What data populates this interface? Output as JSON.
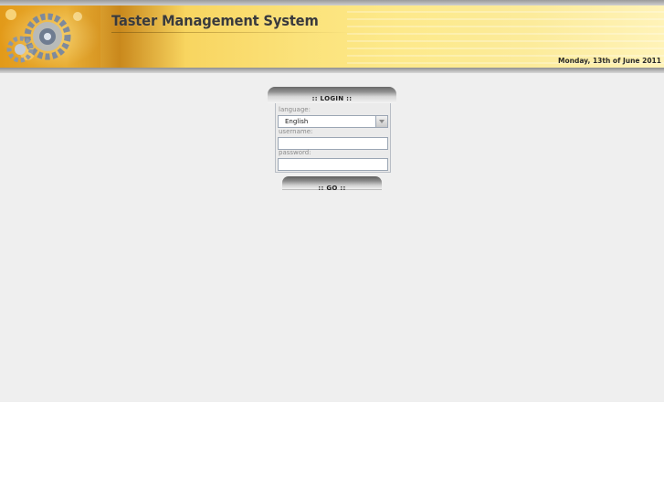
{
  "header": {
    "app_title": "Taster Management System",
    "date": "Monday, 13th of June 2011"
  },
  "login": {
    "title": ":: LOGIN ::",
    "language_label": "language:",
    "language_value": "English",
    "username_label": "username:",
    "username_value": "",
    "password_label": "password:",
    "password_value": "",
    "go_label": ":: GO ::"
  },
  "colors": {
    "page_background": "#efefef",
    "banner_gold": "#f8d560",
    "field_border": "#9ba6b4"
  }
}
